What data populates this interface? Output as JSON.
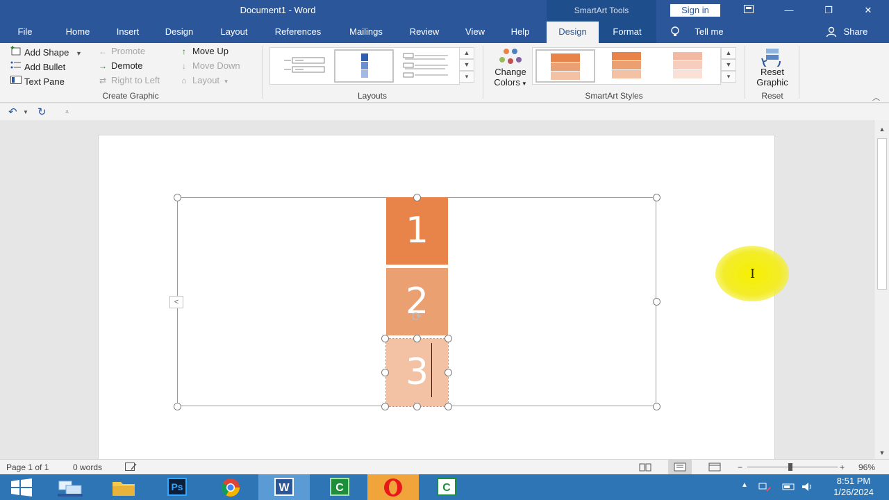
{
  "window": {
    "title": "Document1  -  Word",
    "tools_label": "SmartArt Tools",
    "sign_in": "Sign in",
    "minimize": "—",
    "restore": "❐",
    "close": "✕",
    "ribbon_display_icon": "ribbon-display-options-icon"
  },
  "tabs": [
    {
      "label": "File"
    },
    {
      "label": "Home"
    },
    {
      "label": "Insert"
    },
    {
      "label": "Design"
    },
    {
      "label": "Layout"
    },
    {
      "label": "References"
    },
    {
      "label": "Mailings"
    },
    {
      "label": "Review"
    },
    {
      "label": "View"
    },
    {
      "label": "Help"
    },
    {
      "label": "Design"
    },
    {
      "label": "Format"
    },
    {
      "label": "Tell me"
    },
    {
      "label": "Share"
    }
  ],
  "create_graphic": {
    "add_shape": "Add Shape",
    "add_bullet": "Add Bullet",
    "text_pane": "Text Pane",
    "promote": "Promote",
    "demote": "Demote",
    "right_to_left": "Right to Left",
    "move_up": "Move Up",
    "move_down": "Move Down",
    "layout": "Layout",
    "group_label": "Create Graphic"
  },
  "layouts": {
    "group_label": "Layouts"
  },
  "smartart_styles": {
    "change_colors_1": "Change",
    "change_colors_2": "Colors",
    "group_label": "SmartArt Styles",
    "colors": [
      "#e8834a",
      "#eba072",
      "#f3c2a5"
    ],
    "light_colors": [
      "#f4b9a3",
      "#f7cdbd",
      "#fae0d6"
    ]
  },
  "reset": {
    "reset_graphic_1": "Reset",
    "reset_graphic_2": "Graphic",
    "group_label": "Reset"
  },
  "smartart": {
    "items": [
      {
        "text": "1",
        "color": "#e8834a"
      },
      {
        "text": "2",
        "color": "#eba072"
      },
      {
        "text": "3",
        "color": "#f3c2a5"
      }
    ],
    "text_pane_toggle": "<"
  },
  "statusbar": {
    "page": "Page 1 of 1",
    "words": "0 words",
    "zoom": "96%",
    "zoom_minus": "−",
    "zoom_plus": "+"
  },
  "taskbar": {
    "apps": [
      "windows-start",
      "file-manager",
      "Ps",
      "chrome",
      "W",
      "C",
      "opera",
      "C"
    ],
    "time": "8:51 PM",
    "date": "1/26/2024"
  }
}
